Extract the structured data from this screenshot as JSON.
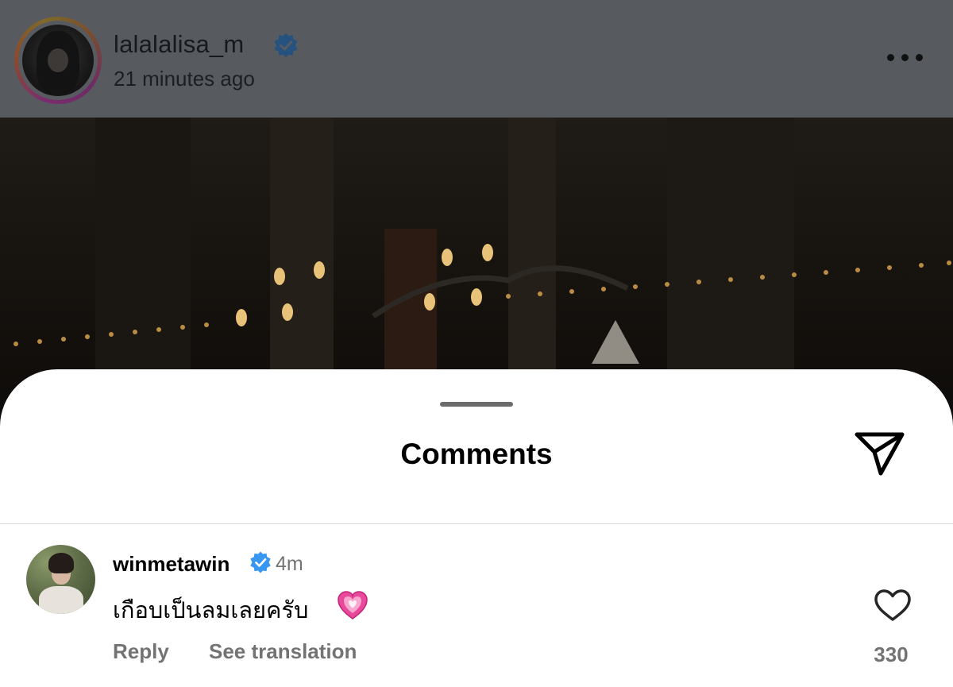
{
  "post": {
    "username": "lalalalisa_m",
    "time": "21 minutes ago"
  },
  "sheet": {
    "title": "Comments"
  },
  "comment": {
    "username": "winmetawin",
    "time": "4m",
    "text": "เกือบเป็นลมเลยครับ",
    "reply_label": "Reply",
    "translate_label": "See translation",
    "like_count": "330"
  },
  "colors": {
    "verified": "#3897f0",
    "secondary_text": "#737373",
    "emoji_heart": "#e8499a"
  },
  "icons": [
    "verified-badge-icon",
    "more-options-icon",
    "share-send-icon",
    "heart-emoji-icon",
    "like-heart-icon"
  ]
}
